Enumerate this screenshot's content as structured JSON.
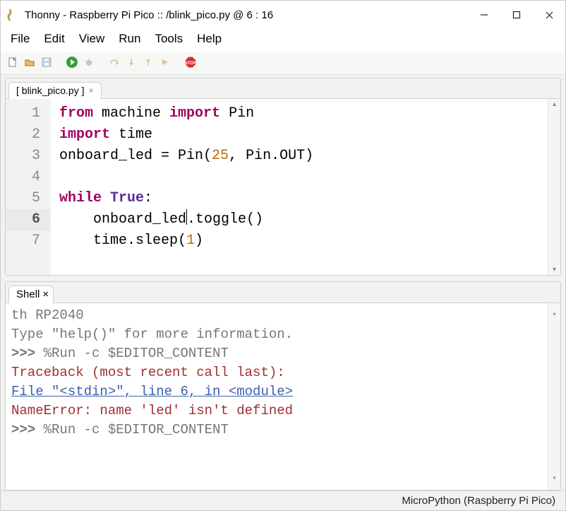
{
  "title": "Thonny  -  Raspberry Pi Pico :: /blink_pico.py  @  6 : 16",
  "menu": {
    "items": [
      "File",
      "Edit",
      "View",
      "Run",
      "Tools",
      "Help"
    ]
  },
  "editor": {
    "tab_label": "[ blink_pico.py ]",
    "cursor_line": 6,
    "lines": [
      {
        "n": 1,
        "tokens": [
          {
            "t": "from",
            "c": "kw"
          },
          {
            "t": " machine ",
            "c": ""
          },
          {
            "t": "import",
            "c": "kw"
          },
          {
            "t": " Pin",
            "c": ""
          }
        ]
      },
      {
        "n": 2,
        "tokens": [
          {
            "t": "import",
            "c": "kw"
          },
          {
            "t": " time",
            "c": ""
          }
        ]
      },
      {
        "n": 3,
        "tokens": [
          {
            "t": "onboard_led = Pin(",
            "c": ""
          },
          {
            "t": "25",
            "c": "num-lit"
          },
          {
            "t": ", Pin.OUT)",
            "c": ""
          }
        ]
      },
      {
        "n": 4,
        "tokens": []
      },
      {
        "n": 5,
        "tokens": [
          {
            "t": "while",
            "c": "kw"
          },
          {
            "t": " ",
            "c": ""
          },
          {
            "t": "True",
            "c": "builtin"
          },
          {
            "t": ":",
            "c": ""
          }
        ]
      },
      {
        "n": 6,
        "tokens": [
          {
            "t": "    onboard_led",
            "c": ""
          },
          {
            "cursor": true
          },
          {
            "t": ".toggle()",
            "c": ""
          }
        ]
      },
      {
        "n": 7,
        "tokens": [
          {
            "t": "    time.sleep(",
            "c": ""
          },
          {
            "t": "1",
            "c": "num-lit"
          },
          {
            "t": ")",
            "c": ""
          }
        ]
      }
    ]
  },
  "shell": {
    "label": "Shell",
    "lines": [
      {
        "segs": [
          {
            "t": "th RP2040",
            "c": ""
          }
        ]
      },
      {
        "segs": [
          {
            "t": "Type \"help()\" for more information.",
            "c": ""
          }
        ]
      },
      {
        "segs": [
          {
            "t": ">>> ",
            "c": "prompt"
          },
          {
            "t": "%Run -c $EDITOR_CONTENT",
            "c": ""
          }
        ]
      },
      {
        "segs": [
          {
            "t": " Traceback (most recent call last):",
            "c": "err"
          }
        ]
      },
      {
        "segs": [
          {
            "t": "   ",
            "c": "err"
          },
          {
            "t": "File \"<stdin>\", line 6, in <module>",
            "c": "link"
          }
        ]
      },
      {
        "segs": [
          {
            "t": " NameError: name 'led' isn't defined",
            "c": "err"
          }
        ]
      },
      {
        "segs": [
          {
            "t": ">>> ",
            "c": "prompt"
          },
          {
            "t": "%Run -c $EDITOR_CONTENT",
            "c": ""
          }
        ]
      }
    ]
  },
  "status": {
    "text": "MicroPython (Raspberry Pi Pico)"
  }
}
